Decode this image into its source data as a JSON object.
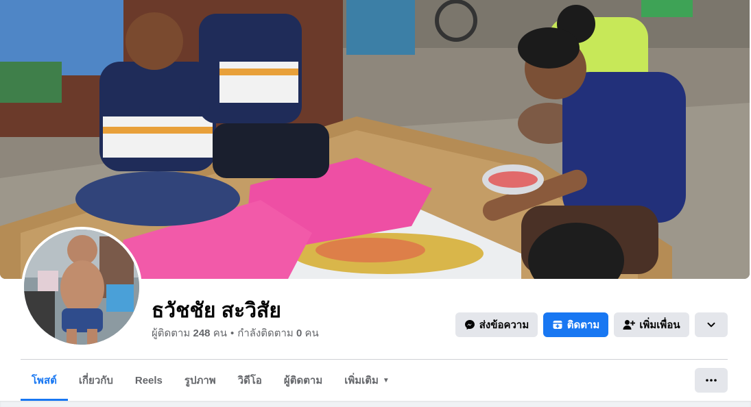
{
  "profile": {
    "name": "ธวัชชัย สะวิสัย",
    "followers_label": "ผู้ติดตาม",
    "followers_count": "248",
    "followers_unit": "คน",
    "following_label": "กำลังติดตาม",
    "following_count": "0",
    "following_unit": "คน"
  },
  "actions": {
    "message": "ส่งข้อความ",
    "follow": "ติดตาม",
    "add_friend": "เพิ่มเพื่อน"
  },
  "tabs": [
    {
      "label": "โพสต์"
    },
    {
      "label": "เกี่ยวกับ"
    },
    {
      "label": "Reels"
    },
    {
      "label": "รูปภาพ"
    },
    {
      "label": "วิดีโอ"
    },
    {
      "label": "ผู้ติดตาม"
    },
    {
      "label": "เพิ่มเติม"
    }
  ],
  "colors": {
    "accent": "#1877f2",
    "button_gray": "#e4e6eb",
    "text_secondary": "#65676b"
  },
  "icons": {
    "message": "messenger-icon",
    "follow": "follow-icon",
    "add_friend": "add-friend-icon",
    "expand": "chevron-down-icon",
    "more": "ellipsis-icon"
  }
}
